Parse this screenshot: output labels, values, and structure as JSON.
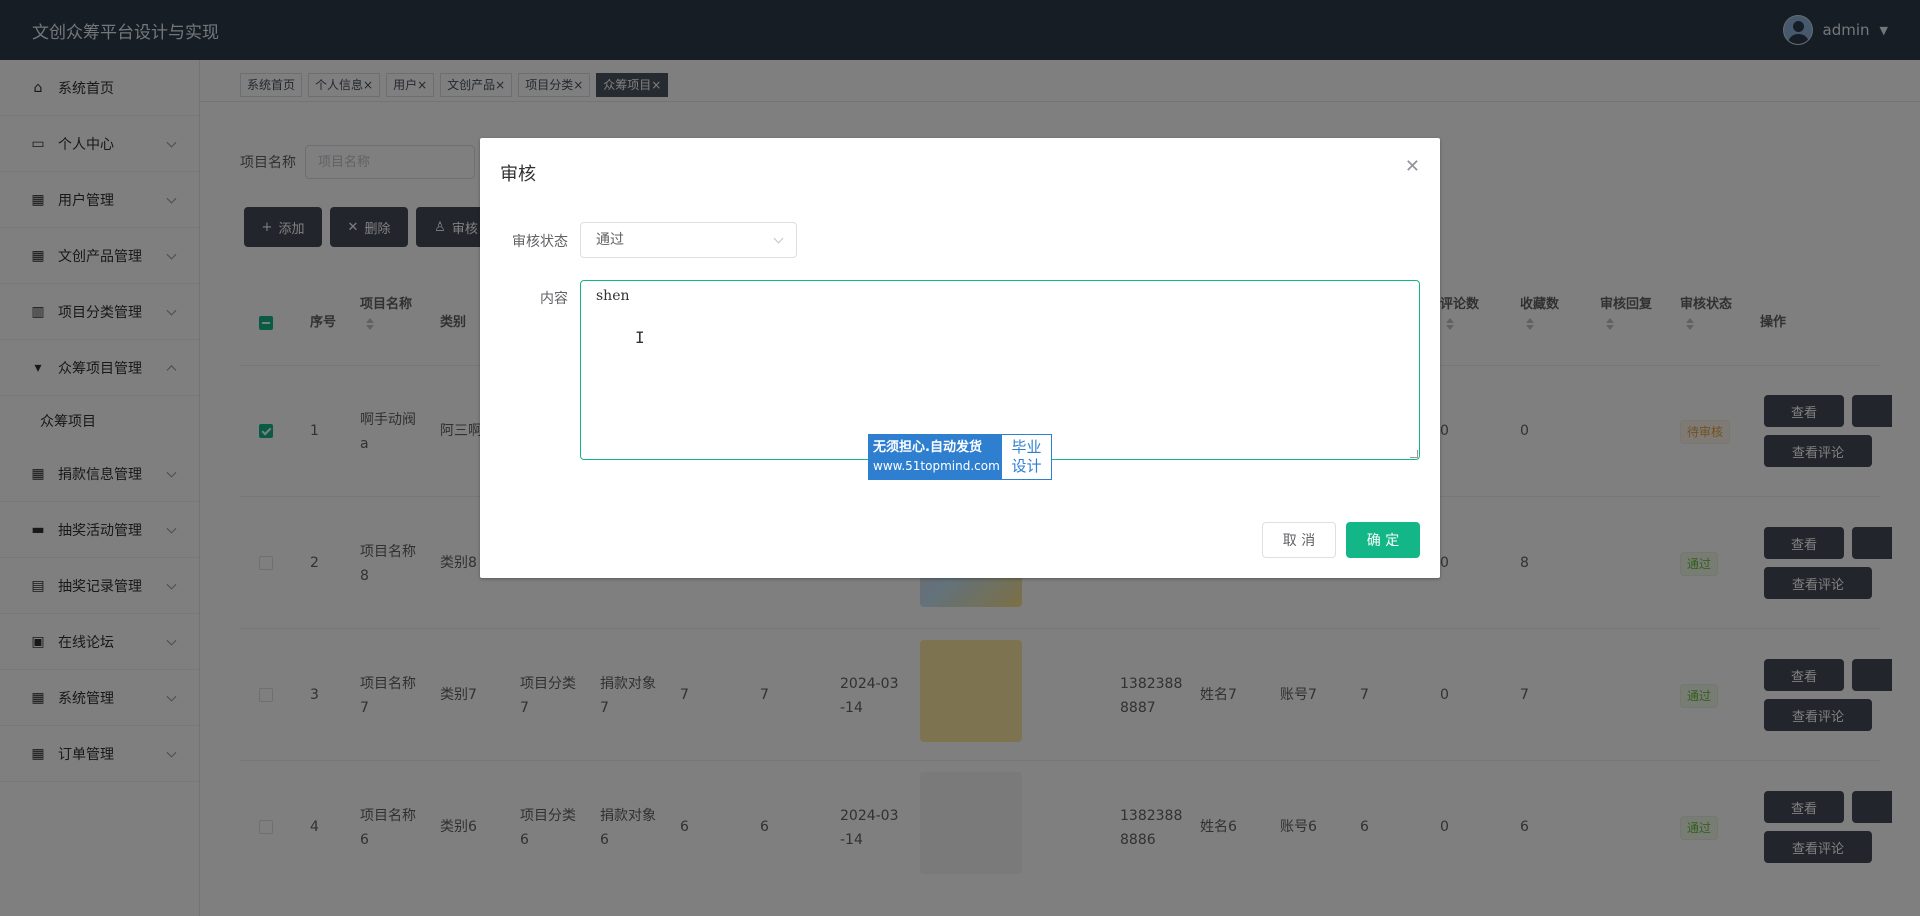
{
  "header": {
    "title": "文创众筹平台设计与实现",
    "username": "admin"
  },
  "sidebar": {
    "items": [
      {
        "label": "系统首页",
        "icon": "home-icon",
        "glyph": "⌂"
      },
      {
        "label": "个人中心",
        "icon": "user-card-icon",
        "glyph": "▭"
      },
      {
        "label": "用户管理",
        "icon": "grid-icon",
        "glyph": "▦"
      },
      {
        "label": "文创产品管理",
        "icon": "grid-icon",
        "glyph": "▦"
      },
      {
        "label": "项目分类管理",
        "icon": "bar-chart-icon",
        "glyph": "▥"
      },
      {
        "label": "众筹项目管理",
        "icon": "hammer-icon",
        "glyph": "▾"
      },
      {
        "label": "捐款信息管理",
        "icon": "grid-icon",
        "glyph": "▦"
      },
      {
        "label": "抽奖活动管理",
        "icon": "message-icon",
        "glyph": "▬"
      },
      {
        "label": "抽奖记录管理",
        "icon": "chart-icon",
        "glyph": "▤"
      },
      {
        "label": "在线论坛",
        "icon": "clipboard-icon",
        "glyph": "▣"
      },
      {
        "label": "系统管理",
        "icon": "grid-icon",
        "glyph": "▦"
      },
      {
        "label": "订单管理",
        "icon": "table-icon",
        "glyph": "▦"
      }
    ],
    "sub_item": "众筹项目"
  },
  "tabs": [
    "系统首页",
    "个人信息×",
    "用户×",
    "文创产品×",
    "项目分类×",
    "众筹项目×"
  ],
  "search": {
    "label": "项目名称",
    "placeholder": "项目名称"
  },
  "actions": {
    "add": "添加",
    "delete": "删除",
    "audit": "审核"
  },
  "table": {
    "headers": {
      "index": "序号",
      "name": "项目名称",
      "category": "类别",
      "comments": "评论数",
      "favorites": "收藏数",
      "reply": "审核回复",
      "status": "审核状态",
      "ops": "操作"
    },
    "rows": [
      {
        "idx": "1",
        "name": "啊手动阀\na",
        "category": "阿三啊",
        "c5": "",
        "c6": "",
        "c7": "",
        "c8": "",
        "date": "",
        "phone": "",
        "realname": "",
        "account": "",
        "clicks": "",
        "comments": "0",
        "favorites": "0",
        "status": "待审核",
        "checked": true
      },
      {
        "idx": "2",
        "name": "项目名称\n8",
        "category": "类别8",
        "c5": "",
        "c6": "",
        "c7": "",
        "c8": "",
        "date": "",
        "phone": "",
        "realname": "",
        "account": "",
        "clicks": "",
        "comments": "0",
        "favorites": "8",
        "status": "通过",
        "checked": false
      },
      {
        "idx": "3",
        "name": "项目名称\n7",
        "category": "类别7",
        "c5": "项目分类\n7",
        "c6": "捐款对象\n7",
        "c7": "7",
        "c8": "7",
        "date": "2024-03\n-14",
        "phone": "1382388\n8887",
        "realname": "姓名7",
        "account": "账号7",
        "clicks": "7",
        "comments": "0",
        "favorites": "7",
        "status": "通过",
        "checked": false
      },
      {
        "idx": "4",
        "name": "项目名称\n6",
        "category": "类别6",
        "c5": "项目分类\n6",
        "c6": "捐款对象\n6",
        "c7": "6",
        "c8": "6",
        "date": "2024-03\n-14",
        "phone": "1382388\n8886",
        "realname": "姓名6",
        "account": "账号6",
        "clicks": "6",
        "comments": "0",
        "favorites": "6",
        "status": "通过",
        "checked": false
      }
    ],
    "btn_view": "查看",
    "btn_comments": "查看评论"
  },
  "dialog": {
    "title": "审核",
    "status_label": "审核状态",
    "status_value": "通过",
    "content_label": "内容",
    "content_value": "shen",
    "cancel": "取 消",
    "confirm": "确 定"
  },
  "watermark": {
    "line1": "无须担心.自动发货",
    "line2": "www.51topmind.com",
    "right1": "毕业",
    "right2": "设计"
  },
  "colors": {
    "primary": "#13b787",
    "header_bg": "#2d3a4b",
    "button_dark": "#454c59"
  }
}
